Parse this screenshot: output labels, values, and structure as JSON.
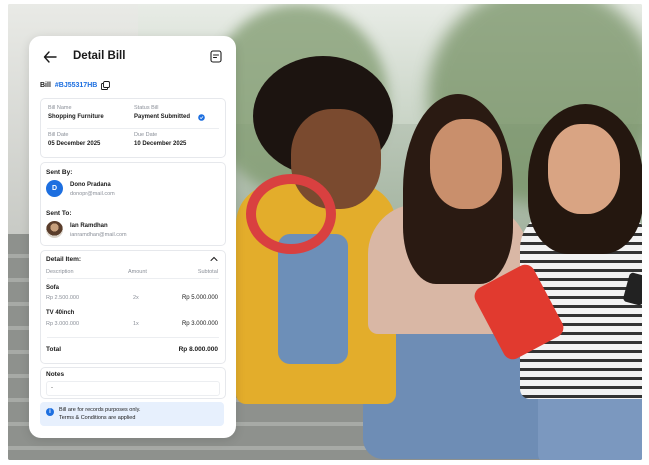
{
  "header": {
    "title": "Detail Bill"
  },
  "bill": {
    "label": "Bill",
    "id": "#BJ55317HB"
  },
  "summary": {
    "bill_name_label": "Bill Name",
    "bill_name": "Shopping Furniture",
    "status_label": "Status Bill",
    "status": "Payment Submitted",
    "bill_date_label": "Bill Date",
    "bill_date": "05 December 2025",
    "due_date_label": "Due Date",
    "due_date": "10 December 2025"
  },
  "parties": {
    "sent_by_label": "Sent By:",
    "sender": {
      "initial": "D",
      "name": "Dono Pradana",
      "email": "donopr@mail.com"
    },
    "sent_to_label": "Sent To:",
    "recipient": {
      "name": "Ian Ramdhan",
      "email": "ianramdhan@mail.com"
    }
  },
  "items": {
    "label": "Detail Item:",
    "columns": [
      "Description",
      "Amount",
      "Subtotal"
    ],
    "rows": [
      {
        "name": "Sofa",
        "price": "Rp 2.500.000",
        "qty": "2x",
        "subtotal": "Rp 5.000.000"
      },
      {
        "name": "TV 40inch",
        "price": "Rp 3.000.000",
        "qty": "1x",
        "subtotal": "Rp 3.000.000"
      }
    ],
    "total_label": "Total",
    "total_value": "Rp 8.000.000"
  },
  "notes": {
    "label": "Notes",
    "value": "-"
  },
  "info": {
    "line1": "Bill are for records purposes only.",
    "line2": "Terms & Conditions are applied"
  },
  "colors": {
    "accent": "#1d6fe0",
    "info_bg": "#e7f0fd"
  }
}
